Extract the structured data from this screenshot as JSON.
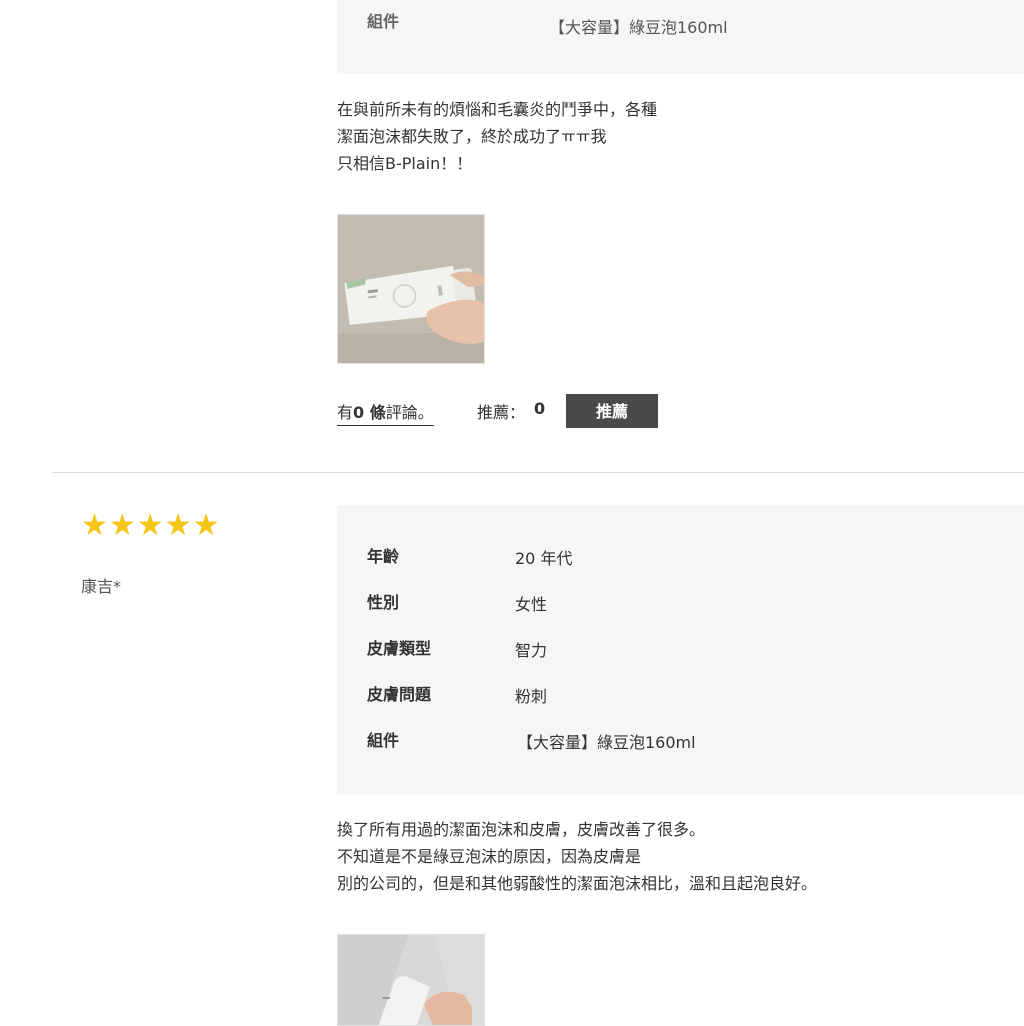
{
  "review_1": {
    "attributes": [
      {
        "label": "組件",
        "value": "【大容量】綠豆泡160ml"
      }
    ],
    "text_lines": [
      "在與前所未有的煩惱和毛囊炎的鬥爭中，各種",
      "潔面泡沫都失敗了，終於成功了ㅠㅠ我",
      "只相信B-Plain！！"
    ],
    "comments_prefix": "有",
    "comments_count": "0 條",
    "comments_suffix": "評論。",
    "recommend_label": "推薦：",
    "recommend_count": "0",
    "recommend_button": "推薦"
  },
  "review_2": {
    "rating": 5,
    "stars": "★★★★★",
    "reviewer": "康吉*",
    "attributes": [
      {
        "label": "年齡",
        "value": "20 年代"
      },
      {
        "label": "性別",
        "value": "女性"
      },
      {
        "label": "皮膚類型",
        "value": "智力"
      },
      {
        "label": "皮膚問題",
        "value": "粉刺"
      },
      {
        "label": "組件",
        "value": "【大容量】綠豆泡160ml"
      }
    ],
    "text_lines": [
      "換了所有用過的潔面泡沫和皮膚，皮膚改善了很多。",
      "不知道是不是綠豆泡沫的原因，因為皮膚是",
      "別的公司的，但是和其他弱酸性的潔面泡沫相比，溫和且起泡良好。"
    ]
  },
  "colors": {
    "star": "#f5c518",
    "button_bg": "#4a4a4a",
    "info_box_bg": "#f6f6f6"
  }
}
